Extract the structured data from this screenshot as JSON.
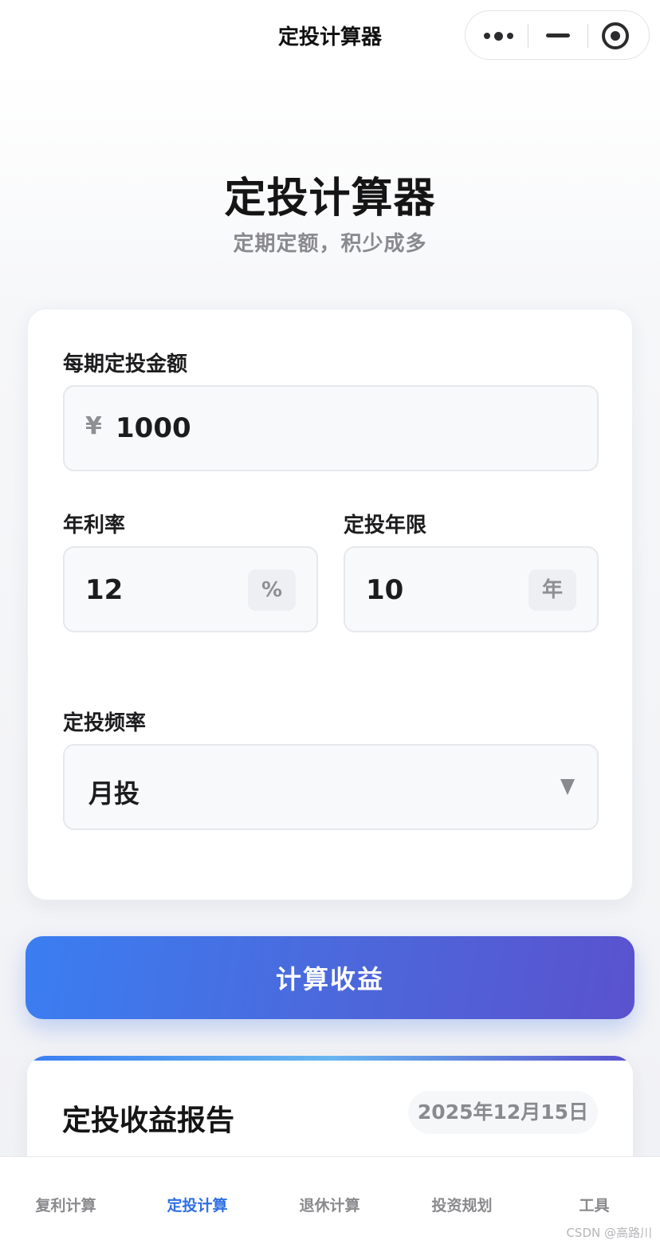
{
  "navbar": {
    "title": "定投计算器"
  },
  "header": {
    "title": "定投计算器",
    "subtitle": "定期定额，积少成多"
  },
  "form": {
    "amount": {
      "label": "每期定投金额",
      "currency": "¥",
      "value": "1000"
    },
    "rate": {
      "label": "年利率",
      "value": "12",
      "unit": "%"
    },
    "years": {
      "label": "定投年限",
      "value": "10",
      "unit": "年"
    },
    "frequency": {
      "label": "定投频率",
      "selected": "月投"
    }
  },
  "calculate_button": "计算收益",
  "report": {
    "title": "定投收益报告",
    "date": "2025年12月15日"
  },
  "tabs": [
    {
      "label": "复利计算"
    },
    {
      "label": "定投计算"
    },
    {
      "label": "退休计算"
    },
    {
      "label": "投资规划"
    },
    {
      "label": "工具"
    }
  ],
  "watermark": "CSDN @高路川",
  "colors": {
    "accent": "#2f6fe4",
    "button_start": "#3a7ef2",
    "button_end": "#5a52ce"
  }
}
